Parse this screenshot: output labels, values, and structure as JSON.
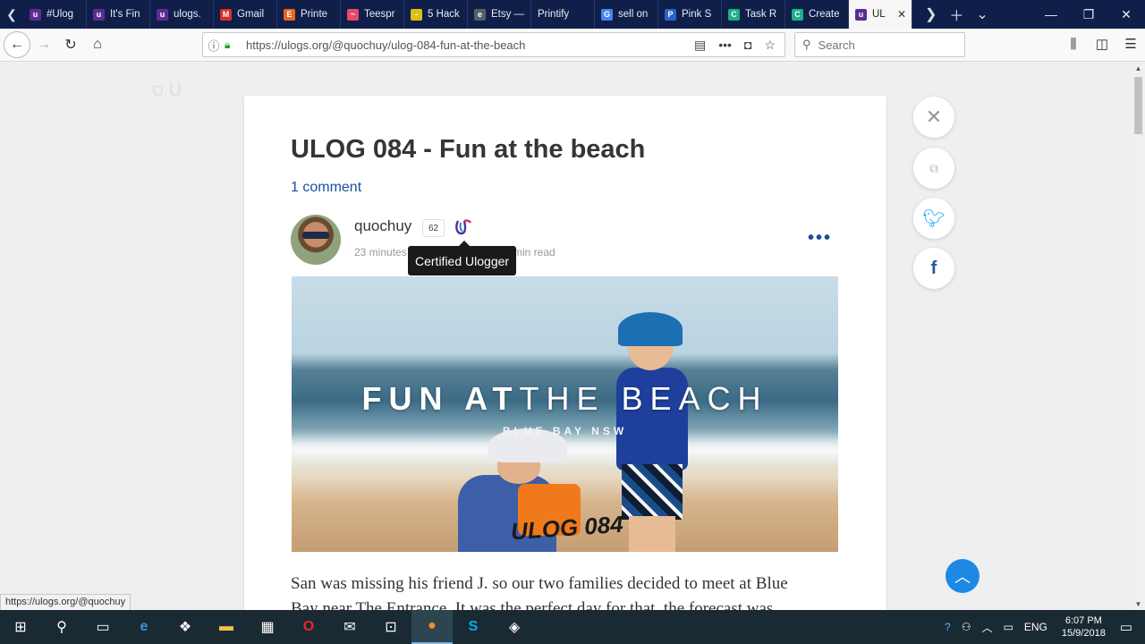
{
  "browser": {
    "tabs": [
      {
        "label": "#Ulog",
        "fav_color": "#5c2d91",
        "fav": "u"
      },
      {
        "label": "It's Fin",
        "fav_color": "#5c2d91",
        "fav": "u"
      },
      {
        "label": "ulogs.",
        "fav_color": "#5c2d91",
        "fav": "u"
      },
      {
        "label": "Gmail",
        "fav_color": "#d93025",
        "fav": "M"
      },
      {
        "label": "Printe",
        "fav_color": "#e8661d",
        "fav": "E"
      },
      {
        "label": "Teespr",
        "fav_color": "#e64b6a",
        "fav": "~"
      },
      {
        "label": "5 Hack",
        "fav_color": "#d9c11a",
        "fav": "-"
      },
      {
        "label": "Etsy —",
        "fav_color": "#555f66",
        "fav": "e"
      },
      {
        "label": "Printify",
        "fav_color": "",
        "fav": ""
      },
      {
        "label": "sell on",
        "fav_color": "#4285f4",
        "fav": "G"
      },
      {
        "label": "Pink S",
        "fav_color": "#2a62c8",
        "fav": "P"
      },
      {
        "label": "Task R",
        "fav_color": "#19b08a",
        "fav": "C"
      },
      {
        "label": "Create",
        "fav_color": "#19b08a",
        "fav": "C"
      },
      {
        "label": "UL",
        "fav_color": "#5c2d91",
        "fav": "u",
        "active": true
      }
    ],
    "url": "https://ulogs.org/@quochuy/ulog-084-fun-at-the-beach",
    "search_placeholder": "Search",
    "status_url": "https://ulogs.org/@quochuy"
  },
  "post": {
    "title": "ULOG 084 - Fun at the beach",
    "comments": "1 comment",
    "author": "quochuy",
    "reputation": "62",
    "time_ago": "23 minutes",
    "read_time": "min read",
    "tooltip": "Certified Ulogger",
    "more": "•••",
    "hero_title_bold": "FUN AT",
    "hero_title_thin": "THE BEACH",
    "hero_subtitle": "BLUE BAY NSW",
    "hero_ulog": "ULOG 084",
    "body_line1": "San was missing his friend J. so our two families decided to meet at Blue",
    "body_line2": "Bay near The Entrance. It was the perfect day for that, the forecast was"
  },
  "taskbar": {
    "language": "ENG",
    "time": "6:07 PM",
    "date": "15/9/2018"
  },
  "colors": {
    "tab_bg": "#0f1f4a",
    "link": "#1a5099",
    "twitter": "#1da1f2",
    "facebook": "#2f5597",
    "scroll_top": "#1e88e5"
  }
}
